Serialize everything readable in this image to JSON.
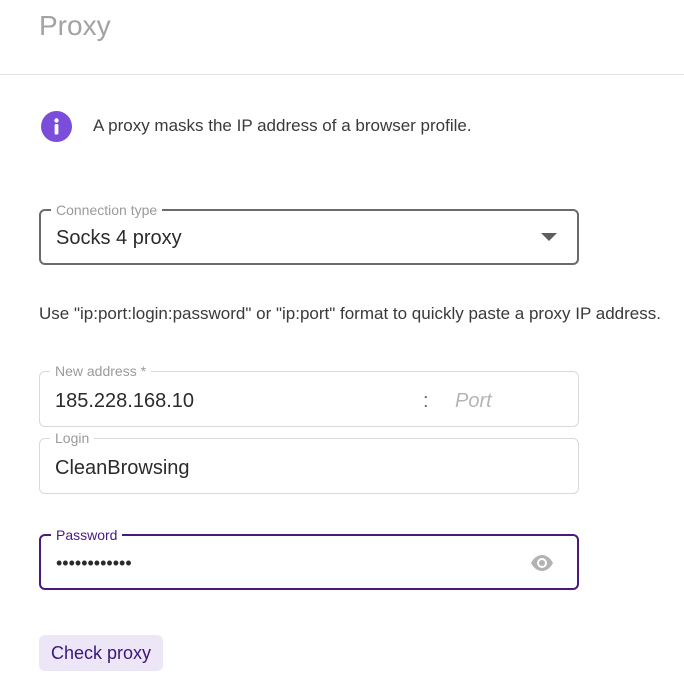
{
  "header": {
    "title": "Proxy"
  },
  "info": {
    "icon": "info-icon",
    "icon_color": "#7b4ddb",
    "text": "A proxy masks the IP address of a browser profile."
  },
  "connection_type": {
    "label": "Connection type",
    "value": "Socks 4 proxy"
  },
  "hint": "Use \"ip:port:login:password\" or \"ip:port\" format to quickly paste a proxy IP address.",
  "address": {
    "label": "New address *",
    "value": "185.228.168.10",
    "separator": ":",
    "port_placeholder": "Port"
  },
  "login": {
    "label": "Login",
    "value": "CleanBrowsing"
  },
  "password": {
    "label": "Password",
    "value": "••••••••••••",
    "accent_color": "#4a1880"
  },
  "actions": {
    "check_proxy": "Check proxy"
  }
}
